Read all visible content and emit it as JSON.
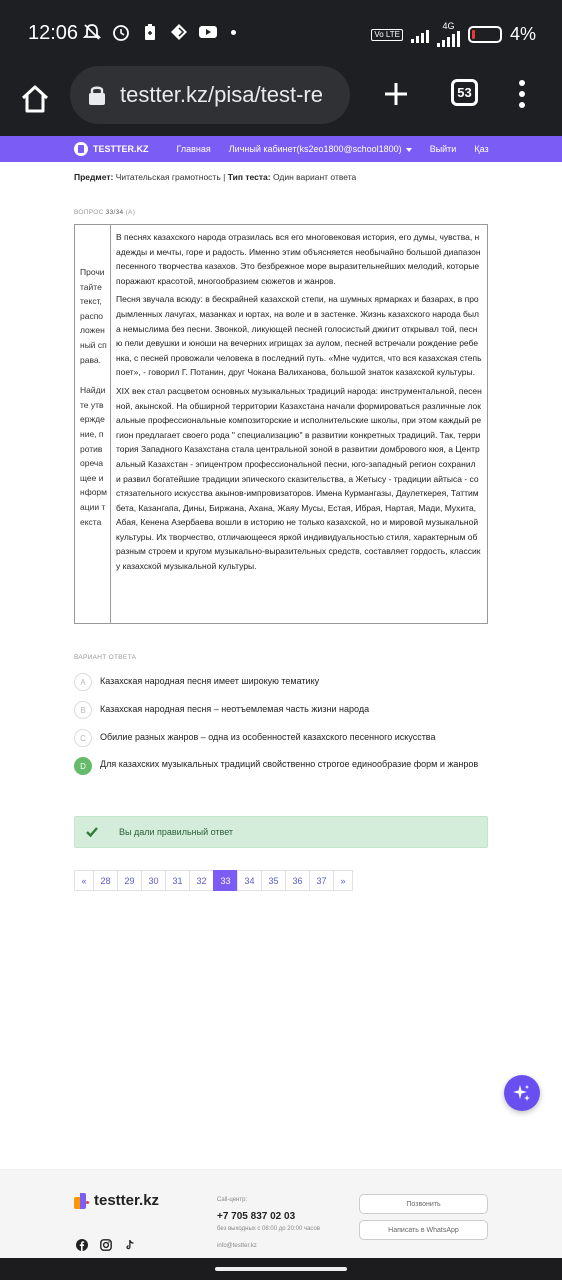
{
  "status_bar": {
    "time": "12:06",
    "network": "4G",
    "battery_percent": "4%",
    "volte_label": "Vo LTE",
    "tabs_count": "53"
  },
  "browser": {
    "url": "testter.kz/pisa/test-re"
  },
  "nav": {
    "logo": "TESTTER.KZ",
    "items": [
      "Главная",
      "Личный кабинет(ks2eo1800@school1800)",
      "Выйти",
      "Қаз"
    ]
  },
  "meta": {
    "subject_label": "Предмет:",
    "subject_value": "Читательская грамотность",
    "separator": "|",
    "type_label": "Тип теста:",
    "type_value": "Один вариант ответа"
  },
  "question": {
    "label": "ВОПРОС",
    "number": "33/34",
    "extra": "(A)",
    "instruction_1": "Прочитайте текст, расположенный справа.",
    "instruction_2": "Найдите утверждение, противоречащее информации текста",
    "paragraphs": [
      "В песнях казахского народа отразилась вся его многовековая история, его думы, чувства, надежды и мечты, горе и радость. Именно этим объясняется необычайно большой диапазон песенного творчества казахов. Это безбрежное море выразительнейших мелодий, которые поражают красотой, многообразием сюжетов и жанров.",
      "Песня звучала всюду: в бескрайней казахской степи, на шумных ярмарках и базарах, в продымленных лачугах, мазанках и юртах, на воле и в застенке. Жизнь казахского народа была немыслима без песни. Звонкой, ликующей песней голосистый джигит открывал той, песню пели девушки и юноши на вечерних игрищах за аулом, песней встречали рождение ребенка, с песней провожали человека в последний путь. «Мне чудится, что вся казахская степь поет», - говорил Г. Потанин, друг Чокана Валиханова, большой знаток казахской культуры.",
      "XIX век стал расцветом основных музыкальных традиций народа: инструментальной, песенной, акынской. На обширной территории Казахстана начали формироваться различные локальные профессиональные композиторские и исполнительские школы, при этом каждый регион предлагает своего рода \" специализацию\" в развитии конкретных традиций. Так, территория Западного Казахстана стала центральной зоной в развитии домбрового кюя, а Центральный Казахстан - эпицентром профессиональной песни, юго-западный регион сохранил и развил богатейшие традиции эпического сказительства, а Жетысу - традиции айтыса - состязательного искусства акынов-импровизаторов. Имена Курмангазы, Даулеткерея, Таттимбета, Казангапа, Дины, Биржана, Ахана, Жаяу Мусы, Естая, Ибрая, Нартая, Мади, Мухита, Абая, Кенена Азербаева вошли в историю не только казахской, но и мировой музыкальной культуры. Их творчество, отличающееся яркой индивидуальностью стиля, характерным образным строем и кругом музыкально-выразительных средств, составляет гордость, классику казахской музыкальной культуры."
    ]
  },
  "answers": {
    "label": "ВАРИАНТ ОТВЕТА",
    "options": [
      {
        "letter": "A",
        "text": "Казахская народная песня имеет широкую тематику"
      },
      {
        "letter": "B",
        "text": "Казахская народная песня – неотъемлемая часть жизни народа"
      },
      {
        "letter": "C",
        "text": "Обилие разных жанров – одна из особенностей казахского песенного искусства"
      },
      {
        "letter": "D",
        "text": "Для казахских музыкальных традиций свойственно строгое единообразие форм и жанров"
      }
    ],
    "selected": "D"
  },
  "result": {
    "message": "Вы дали правильный ответ"
  },
  "pagination": {
    "prev": "«",
    "pages": [
      "28",
      "29",
      "30",
      "31",
      "32",
      "33",
      "34",
      "35",
      "36",
      "37"
    ],
    "current": "33",
    "next": "»"
  },
  "footer": {
    "logo": "testter.kz",
    "call_center_label": "Call-центр:",
    "phone": "+7 705 837 02 03",
    "hours": "без выходных с 08:00 до 20:00 часов",
    "email": "info@testter.kz",
    "call_button": "Позвонить",
    "whatsapp_button": "Написать в WhatsApp"
  },
  "colors": {
    "brand": "#7b5cf5",
    "correct": "#66bb6a",
    "success_bg": "#d4edda"
  }
}
